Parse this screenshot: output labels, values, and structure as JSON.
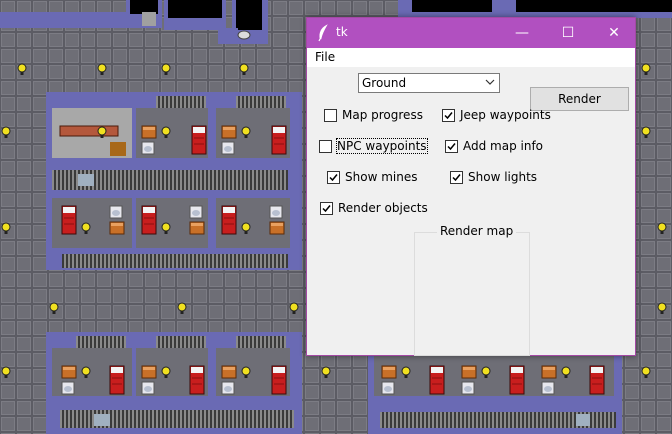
{
  "window": {
    "title": "tk",
    "controls": {
      "minimize": "—",
      "maximize": "☐",
      "close": "✕"
    }
  },
  "menu": {
    "file": "File"
  },
  "layer_select": {
    "value": "Ground"
  },
  "render_button": "Render",
  "options": {
    "map_progress": {
      "label": "Map progress",
      "checked": false
    },
    "jeep_waypoints": {
      "label": "Jeep waypoints",
      "checked": true
    },
    "npc_waypoints": {
      "label": "NPC waypoints",
      "checked": false
    },
    "add_map_info": {
      "label": "Add map info",
      "checked": true
    },
    "show_mines": {
      "label": "Show mines",
      "checked": true
    },
    "show_lights": {
      "label": "Show lights",
      "checked": true
    },
    "render_objects": {
      "label": "Render objects",
      "checked": true
    }
  },
  "render_map_group": "Render map",
  "colors": {
    "titlebar": "#b150c0",
    "floor": "#6e6e76",
    "wall": "#6a6ab4",
    "bed": "#c81e1e",
    "lamp": "#f0e020"
  }
}
